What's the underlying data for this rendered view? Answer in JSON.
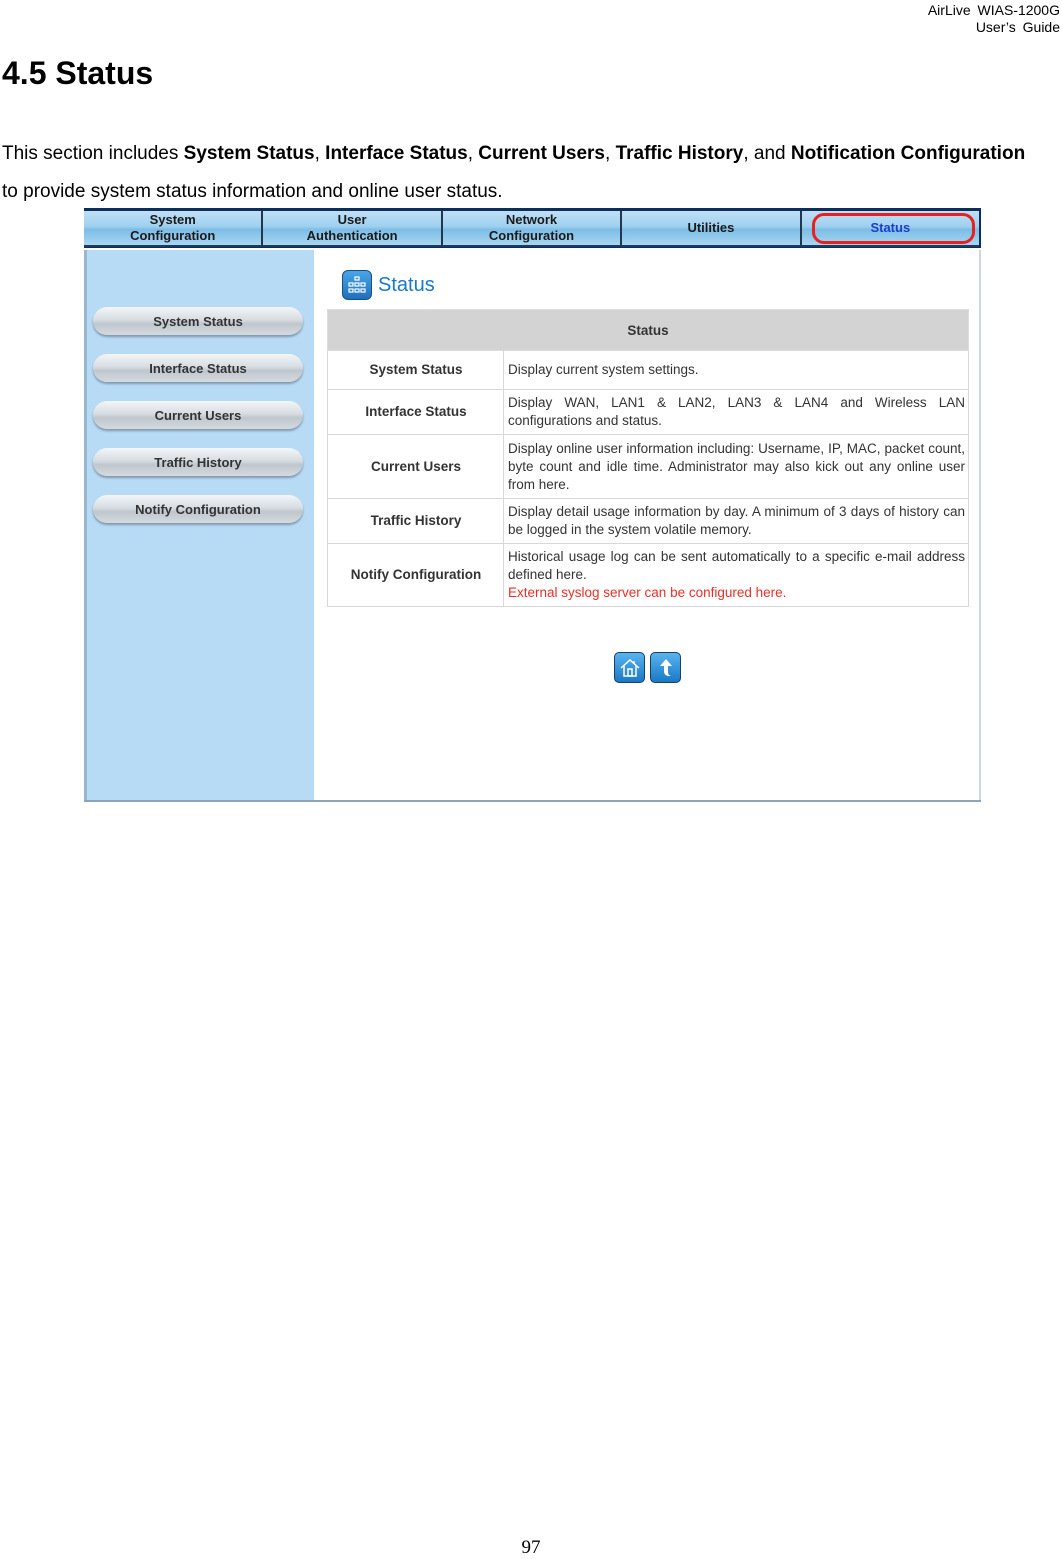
{
  "header": {
    "line1": "AirLive WIAS-1200G",
    "line2": "User’s Guide"
  },
  "heading": "4.5 Status",
  "intro": {
    "t1": "This section includes ",
    "b1": "System Status",
    "t2": ", ",
    "b2": "Interface Status",
    "t3": ", ",
    "b3": "Current Users",
    "t4": ", ",
    "b4": "Traffic History",
    "t5": ", and ",
    "b5": "Notification Configuration",
    "t6": " to provide system status information and online user status."
  },
  "screenshot": {
    "top_nav": [
      {
        "line1": "System",
        "line2": "Configuration"
      },
      {
        "line1": "User",
        "line2": "Authentication"
      },
      {
        "line1": "Network",
        "line2": "Configuration"
      },
      {
        "line1": "Utilities",
        "line2": ""
      },
      {
        "line1": "Status",
        "line2": "",
        "active": true
      }
    ],
    "highlight_color": "#e82020",
    "sidebar": [
      "System Status",
      "Interface Status",
      "Current Users",
      "Traffic History",
      "Notify Configuration"
    ],
    "page_title": "Status",
    "table": {
      "header": "Status",
      "rows": [
        {
          "name": "System Status",
          "desc": "Display current system settings.",
          "note": ""
        },
        {
          "name": "Interface Status",
          "desc": "Display WAN, LAN1 & LAN2, LAN3 & LAN4 and Wireless LAN configurations and status.",
          "note": ""
        },
        {
          "name": "Current Users",
          "desc": "Display online user information including: Username, IP, MAC, packet count, byte count and idle time. Administrator may also kick out any online user from here.",
          "note": ""
        },
        {
          "name": "Traffic History",
          "desc": "Display detail usage information by day. A minimum of 3 days of history can be logged in the system volatile memory.",
          "note": ""
        },
        {
          "name": "Notify Configuration",
          "desc": "Historical usage log can be sent automatically to a specific e-mail address defined here.",
          "note": "External syslog server can be configured here."
        }
      ]
    },
    "bottom_icons": [
      "home-icon",
      "up-arrow-icon"
    ]
  },
  "page_number": "97"
}
